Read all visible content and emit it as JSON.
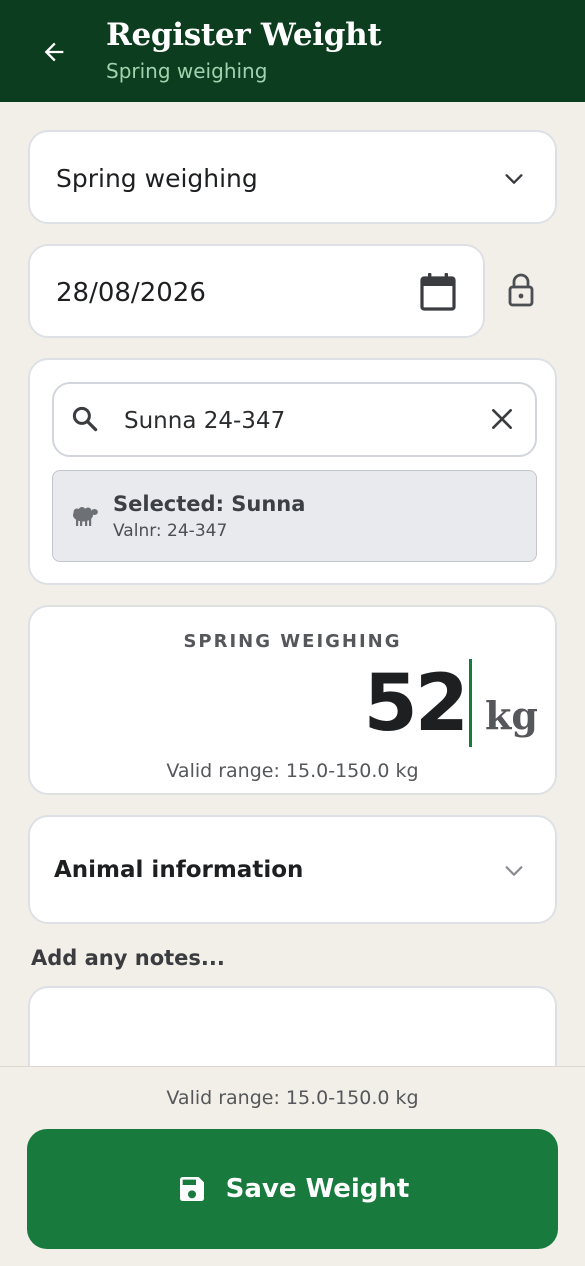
{
  "header": {
    "title": "Register Weight",
    "subtitle": "Spring weighing"
  },
  "weighing_type": {
    "selected": "Spring weighing"
  },
  "date": {
    "value": "28/08/2026"
  },
  "search": {
    "value": "Sunna 24-347"
  },
  "selected_animal": {
    "title": "Selected: Sunna",
    "subtitle": "Valnr: 24-347"
  },
  "weight": {
    "label": "SPRING WEIGHING",
    "value": "52",
    "unit": "kg",
    "range": "Valid range: 15.0-150.0 kg"
  },
  "animal_info": {
    "label": "Animal information"
  },
  "notes": {
    "label": "Add any notes..."
  },
  "footer": {
    "range": "Valid range: 15.0-150.0 kg",
    "save_label": "Save Weight"
  },
  "colors": {
    "header_bg": "#0d3d1f",
    "accent": "#197a3e",
    "subtitle": "#9fd3ad",
    "page_bg": "#f2efe8"
  }
}
